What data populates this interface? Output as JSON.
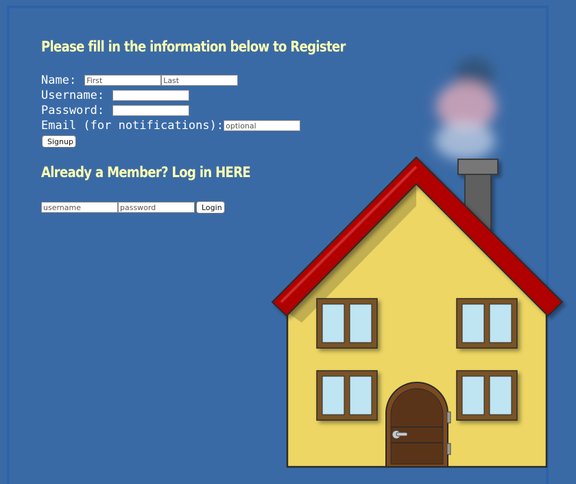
{
  "register": {
    "heading": "Please fill in the information below to Register",
    "name_label": "Name:",
    "first_placeholder": "First",
    "last_placeholder": "Last",
    "username_label": "Username:",
    "password_label": "Password:",
    "email_label": "Email (for notifications):",
    "email_placeholder": "optional",
    "signup_label": "Signup"
  },
  "login": {
    "heading": "Already a Member? Log in HERE",
    "username_placeholder": "username",
    "password_placeholder": "password",
    "login_label": "Login"
  },
  "colors": {
    "background": "#3a6aa6",
    "heading": "#ffffb3",
    "house_wall": "#edd663",
    "roof": "#a00000",
    "window_frame": "#7a5226",
    "door": "#5a3418"
  },
  "icons": {
    "house": "house-illustration"
  }
}
